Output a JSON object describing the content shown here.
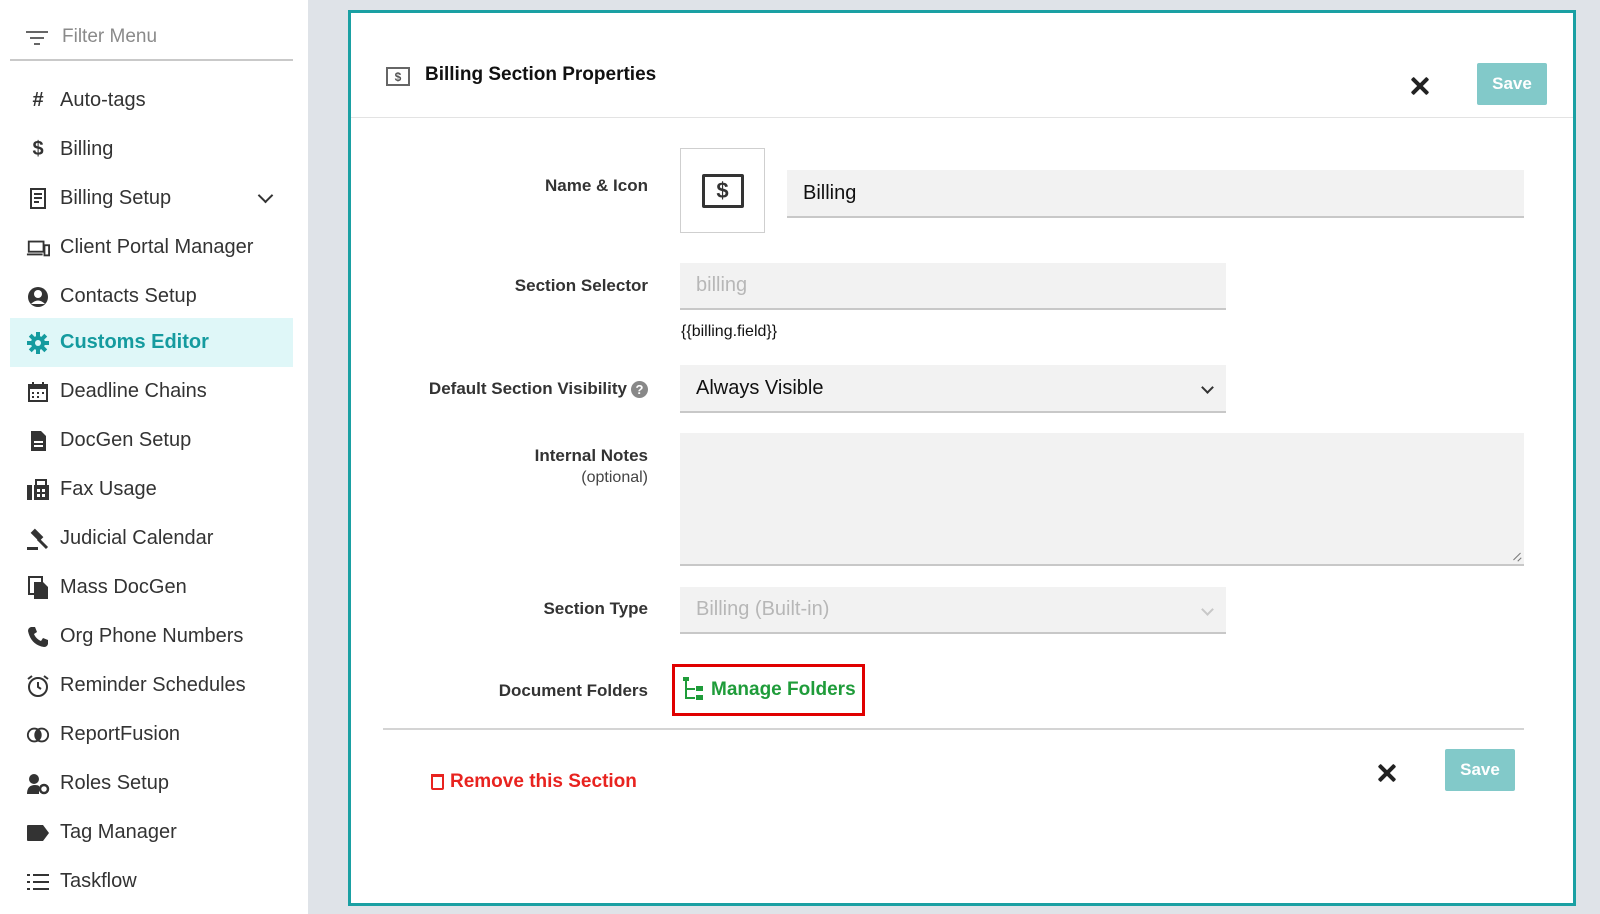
{
  "sidebar": {
    "filter_placeholder": "Filter Menu",
    "items": [
      {
        "label": "Auto-tags",
        "icon": "hash-icon"
      },
      {
        "label": "Billing",
        "icon": "dollar-icon"
      },
      {
        "label": "Billing Setup",
        "icon": "receipt-icon"
      },
      {
        "label": "Client Portal Manager",
        "icon": "devices-icon"
      },
      {
        "label": "Contacts Setup",
        "icon": "user-circle-icon"
      },
      {
        "label": "Customs Editor",
        "icon": "gear-icon",
        "active": true
      },
      {
        "label": "Deadline Chains",
        "icon": "calendar-icon"
      },
      {
        "label": "DocGen Setup",
        "icon": "document-icon"
      },
      {
        "label": "Fax Usage",
        "icon": "fax-icon"
      },
      {
        "label": "Judicial Calendar",
        "icon": "gavel-icon"
      },
      {
        "label": "Mass DocGen",
        "icon": "documents-icon"
      },
      {
        "label": "Org Phone Numbers",
        "icon": "phone-icon"
      },
      {
        "label": "Reminder Schedules",
        "icon": "alarm-clock-icon"
      },
      {
        "label": "ReportFusion",
        "icon": "fusion-icon"
      },
      {
        "label": "Roles Setup",
        "icon": "user-cog-icon"
      },
      {
        "label": "Tag Manager",
        "icon": "tag-icon"
      },
      {
        "label": "Taskflow",
        "icon": "list-icon"
      }
    ]
  },
  "panel": {
    "title": "Billing Section Properties",
    "save_label": "Save",
    "name_icon_label": "Name & Icon",
    "name_value": "Billing",
    "section_selector_label": "Section Selector",
    "section_selector_value": "billing",
    "selector_hint": "{{billing.field}}",
    "visibility_label": "Default Section Visibility",
    "visibility_value": "Always Visible",
    "notes_label": "Internal Notes",
    "notes_optional": "(optional)",
    "notes_value": "",
    "section_type_label": "Section Type",
    "section_type_value": "Billing (Built-in)",
    "document_folders_label": "Document Folders",
    "manage_folders_label": "Manage Folders",
    "remove_label": "Remove this Section",
    "footer_save_label": "Save"
  },
  "colors": {
    "accent": "#1aa0a3",
    "save_button": "#82c9c9",
    "danger": "#e8231f",
    "success": "#1f9c3a",
    "highlight_box": "#e00000"
  }
}
